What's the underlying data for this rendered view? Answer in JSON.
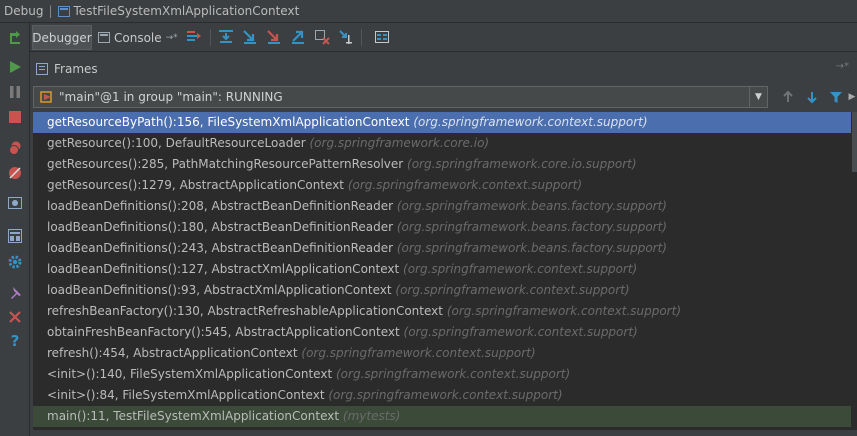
{
  "window": {
    "debug_label": "Debug",
    "config_name": "TestFileSystemXmlApplicationContext"
  },
  "toolbar": {
    "tabs": [
      {
        "label": "Debugger",
        "active": true
      },
      {
        "label": "Console",
        "active": false
      }
    ],
    "actions": [
      {
        "icon": "show-execution-point-icon"
      },
      {
        "icon": "step-over-icon"
      },
      {
        "icon": "step-into-icon"
      },
      {
        "icon": "force-step-into-icon"
      },
      {
        "icon": "step-out-icon"
      },
      {
        "icon": "drop-frame-icon"
      },
      {
        "icon": "run-to-cursor-icon"
      },
      {
        "icon": "evaluate-expression-icon"
      }
    ]
  },
  "left_toolbar": [
    {
      "icon": "rerun-icon",
      "color": "#4e9a49"
    },
    {
      "icon": "resume-icon",
      "color": "#4e9a49"
    },
    {
      "icon": "pause-icon",
      "color": "#8a8a8a"
    },
    {
      "icon": "stop-icon",
      "color": "#c75450"
    },
    {
      "icon": "view-breakpoints-icon",
      "color": "#c75450"
    },
    {
      "icon": "mute-breakpoints-icon",
      "color": "#c75450"
    },
    {
      "icon": "get-thread-dump-icon",
      "color": "#8fa8c8"
    },
    {
      "icon": "restore-layout-icon",
      "color": "#8fa8c8"
    },
    {
      "icon": "settings-icon",
      "color": "#3592c4"
    },
    {
      "icon": "pin-tab-icon",
      "color": "#b07cc6"
    },
    {
      "icon": "close-icon",
      "color": "#c75450"
    },
    {
      "icon": "help-icon",
      "color": "#3592c4"
    }
  ],
  "frames": {
    "title": "Frames",
    "thread_selector": "\"main\"@1 in group \"main\": RUNNING",
    "items": [
      {
        "method": "getResourceByPath():156, FileSystemXmlApplicationContext",
        "package": "(org.springframework.context.support)"
      },
      {
        "method": "getResource():100, DefaultResourceLoader",
        "package": "(org.springframework.core.io)"
      },
      {
        "method": "getResources():285, PathMatchingResourcePatternResolver",
        "package": "(org.springframework.core.io.support)"
      },
      {
        "method": "getResources():1279, AbstractApplicationContext",
        "package": "(org.springframework.context.support)"
      },
      {
        "method": "loadBeanDefinitions():208, AbstractBeanDefinitionReader",
        "package": "(org.springframework.beans.factory.support)"
      },
      {
        "method": "loadBeanDefinitions():180, AbstractBeanDefinitionReader",
        "package": "(org.springframework.beans.factory.support)"
      },
      {
        "method": "loadBeanDefinitions():243, AbstractBeanDefinitionReader",
        "package": "(org.springframework.beans.factory.support)"
      },
      {
        "method": "loadBeanDefinitions():127, AbstractXmlApplicationContext",
        "package": "(org.springframework.context.support)"
      },
      {
        "method": "loadBeanDefinitions():93, AbstractXmlApplicationContext",
        "package": "(org.springframework.context.support)"
      },
      {
        "method": "refreshBeanFactory():130, AbstractRefreshableApplicationContext",
        "package": "(org.springframework.context.support)"
      },
      {
        "method": "obtainFreshBeanFactory():545, AbstractApplicationContext",
        "package": "(org.springframework.context.support)"
      },
      {
        "method": "refresh():454, AbstractApplicationContext",
        "package": "(org.springframework.context.support)"
      },
      {
        "method": "<init>():140, FileSystemXmlApplicationContext",
        "package": "(org.springframework.context.support)"
      },
      {
        "method": "<init>():84, FileSystemXmlApplicationContext",
        "package": "(org.springframework.context.support)"
      },
      {
        "method": "main():11, TestFileSystemXmlApplicationContext",
        "package": "(mytests)"
      }
    ]
  },
  "colors": {
    "background": "#3c3f41",
    "list_background": "#2b2b2b",
    "selection": "#4b6eaf",
    "user_frame": "#3b4a39",
    "package_text": "#6b6b6b"
  }
}
